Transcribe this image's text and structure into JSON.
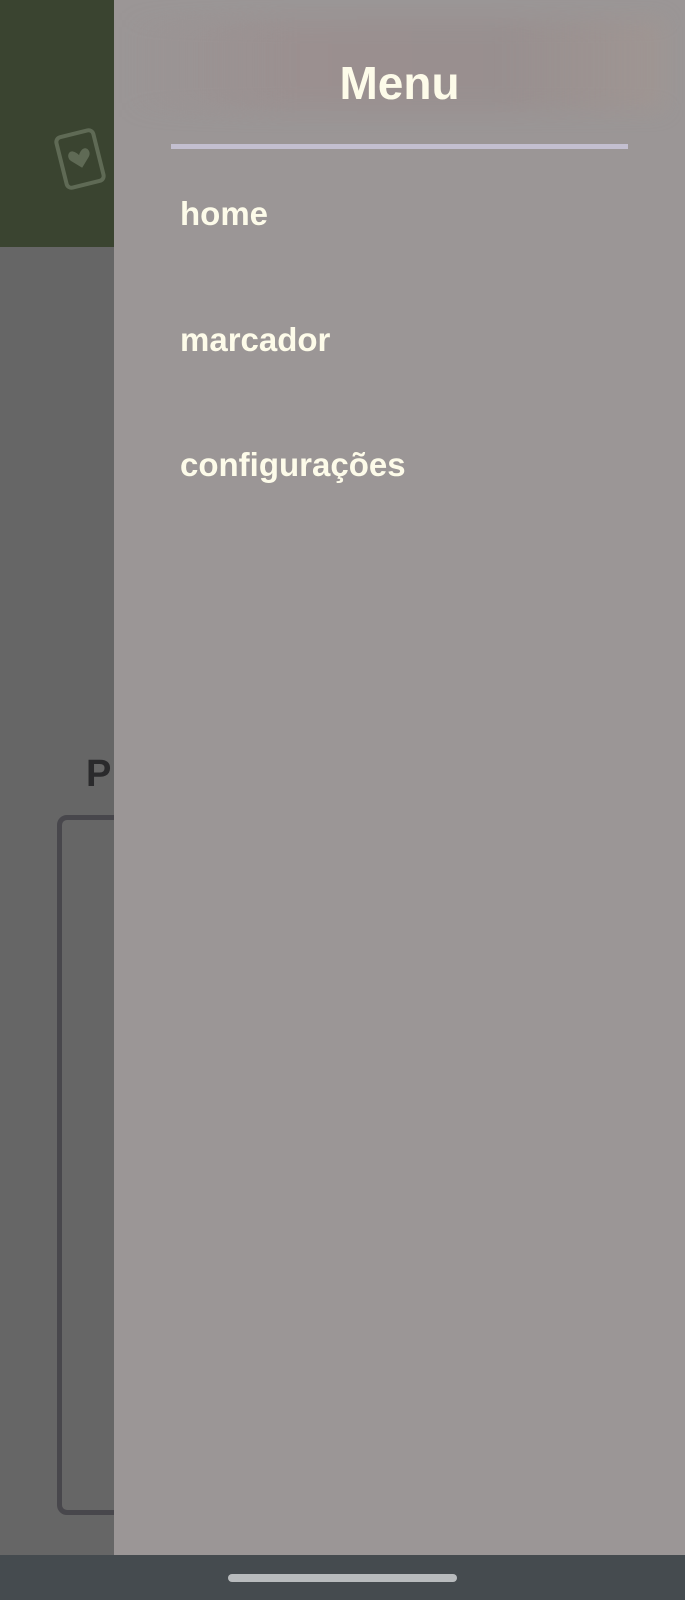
{
  "background": {
    "section_title": "P",
    "colors": {
      "header": "#3a4430",
      "body": "#666666"
    },
    "header_icon": "playing-card-heart-icon"
  },
  "drawer": {
    "title": "Menu",
    "items": [
      {
        "label": "home"
      },
      {
        "label": "marcador"
      },
      {
        "label": "configurações"
      }
    ],
    "colors": {
      "background": "#9b9696",
      "text": "#fdfbe9",
      "divider": "#c3bfd0"
    }
  },
  "system_nav": {
    "handle": "gesture-handle"
  }
}
